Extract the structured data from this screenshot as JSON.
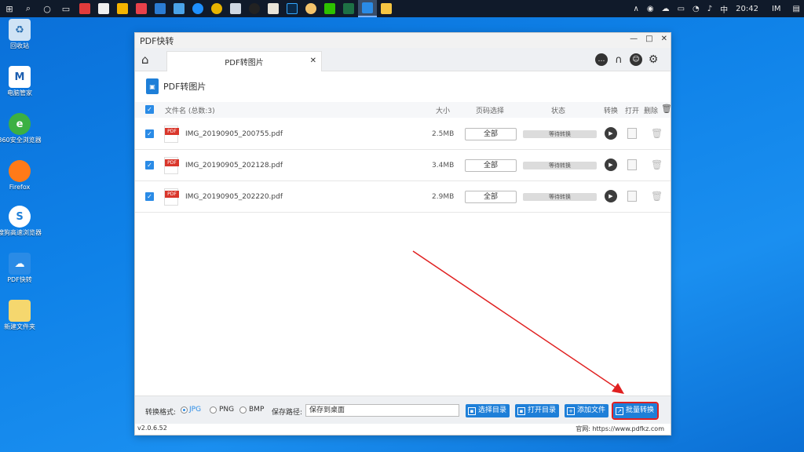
{
  "taskbar": {
    "clock": "20:42",
    "ime": "中",
    "tray_label": "IM"
  },
  "desktop": {
    "icons": [
      {
        "label": "回收站"
      },
      {
        "label": "电脑管家"
      },
      {
        "label": "360安全浏览器"
      },
      {
        "label": "Firefox"
      },
      {
        "label": "搜狗高速浏览器"
      },
      {
        "label": "PDF快转"
      },
      {
        "label": "新建文件夹"
      }
    ]
  },
  "window": {
    "title": "PDF快转",
    "tab_label": "PDF转图片",
    "section_title": "PDF转图片",
    "columns": {
      "name": "文件名 (总数:3)",
      "size": "大小",
      "pages": "页码选择",
      "status": "状态",
      "convert": "转换",
      "open": "打开",
      "delete": "删除"
    },
    "rows": [
      {
        "name": "IMG_20190905_200755.pdf",
        "size": "2.5MB",
        "pages": "全部",
        "status": "等待转换"
      },
      {
        "name": "IMG_20190905_202128.pdf",
        "size": "3.4MB",
        "pages": "全部",
        "status": "等待转换"
      },
      {
        "name": "IMG_20190905_202220.pdf",
        "size": "2.9MB",
        "pages": "全部",
        "status": "等待转换"
      }
    ],
    "bottom": {
      "format_label": "转换格式:",
      "formats": [
        "JPG",
        "PNG",
        "BMP"
      ],
      "selected_format": "JPG",
      "path_label": "保存路径:",
      "path_value": "保存到桌面",
      "btn_choose_dir": "选择目录",
      "btn_open_dir": "打开目录",
      "btn_add_file": "添加文件",
      "btn_batch": "批量转换"
    },
    "version": "v2.0.6.52",
    "website": "官网: https://www.pdfkz.com"
  },
  "colors": {
    "accent": "#1e7fd8",
    "highlight": "#e02020",
    "desktop": "#0f82e8"
  }
}
